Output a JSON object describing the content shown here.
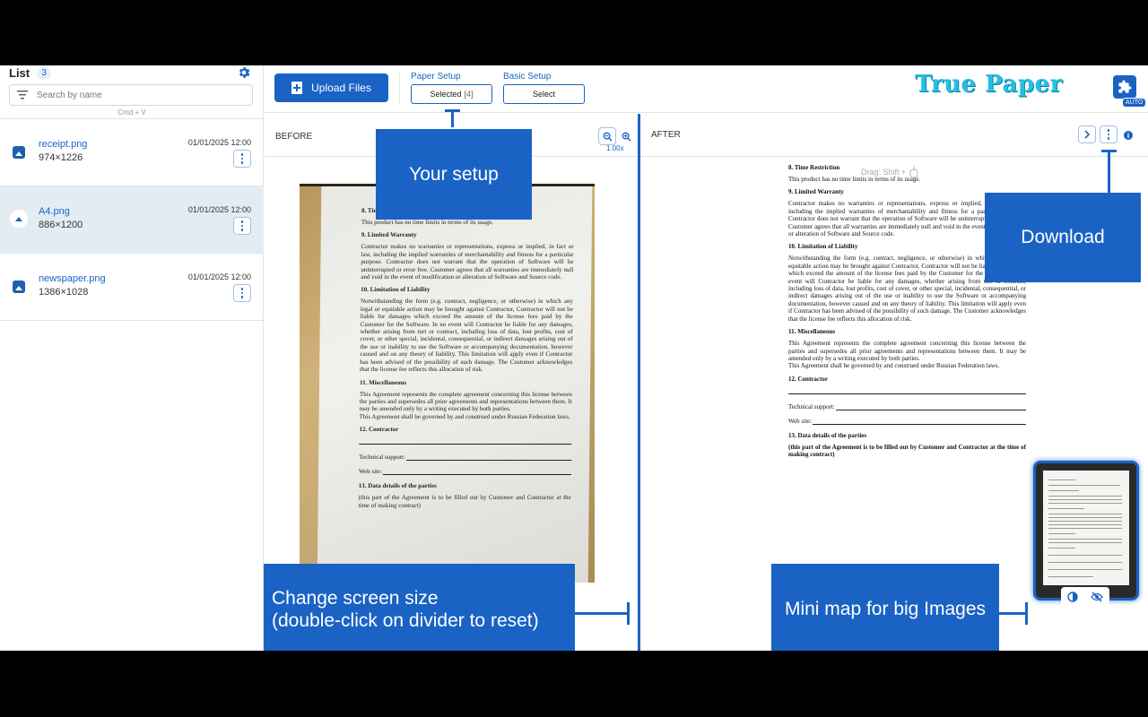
{
  "sidebar": {
    "title": "List",
    "count": "3",
    "search_placeholder": "Search by name",
    "hint": "Cmd + V",
    "files": [
      {
        "name": "receipt.png",
        "dims": "974×1226",
        "date": "01/01/2025 12:00",
        "active": false
      },
      {
        "name": "A4.png",
        "dims": "886×1200",
        "date": "01/01/2025 12:00",
        "active": true
      },
      {
        "name": "newspaper.png",
        "dims": "1386×1028",
        "date": "01/01/2025 12:00",
        "active": false
      }
    ]
  },
  "toolbar": {
    "upload_label": "Upload Files",
    "paper_setup_label": "Paper Setup",
    "paper_setup_value": "Selected",
    "paper_setup_count": "[4]",
    "basic_setup_label": "Basic Setup",
    "basic_setup_value": "Select",
    "brand": "True Paper",
    "auto_tag": "AUTO"
  },
  "before_pane": {
    "title": "BEFORE",
    "zoom": "1.00x"
  },
  "after_pane": {
    "title": "AFTER",
    "drag_hint": "Drag: Shift +"
  },
  "document": {
    "s8_title": "8. Time Restriction",
    "s8_body": "This product has no time limits in terms of its usage.",
    "s9_title": "9. Limited Warranty",
    "s9_body": "Contractor makes no warranties or representations, express or implied, in fact or law, including the implied warranties of merchantability and fitness for a particular purpose. Contractor does not warrant that the operation of Software will be uninterrupted or error free. Customer agrees that all warranties are immediately null and void in the event of modification or alteration of Software and Source code.",
    "s10_title": "10. Limitation of Liability",
    "s10_body": "Notwithstanding the form (e.g. contract, negligence, or otherwise) in which any legal or equitable action may be brought against Contractor, Contractor will not be liable for damages which exceed the amount of the license fees paid by the Customer for the Software. In no event will Contractor be liable for any damages, whether arising from tort or contract, including loss of data, lost profits, cost of cover, or other special, incidental, consequential, or indirect damages arising out of the use or inability to use the Software or accompanying documentation, however caused and on any theory of liability. This limitation will apply even if Contractor has been advised of the possibility of such damage. The Customer acknowledges that the license fee reflects this allocation of risk.",
    "s11_title": "11. Miscellaneous",
    "s11_body": "This Agreement represents the complete agreement concerning this license between the parties and supersedes all prior agreements and representations between them. It may be amended only by a writing executed by both parties.",
    "s11_body2": "This Agreement shall be governed by and construed under Russian Federation laws.",
    "s12_title": "12. Contractor",
    "tech_support": "Technical support:",
    "web_site": "Web site:",
    "s13_title": "13. Data details of the parties",
    "s13_body": "(this part of the Agreement is to be filled out by Customer and Contractor at the time of making contract)"
  },
  "callouts": {
    "your_setup": "Your setup",
    "download": "Download",
    "screen_size": "Change screen size\n(double-click on divider to reset)",
    "mini_map": "Mini map for big Images"
  },
  "colors": {
    "accent": "#1a63c5",
    "brand": "#27bfe4",
    "active_row": "#e4ecf3"
  }
}
